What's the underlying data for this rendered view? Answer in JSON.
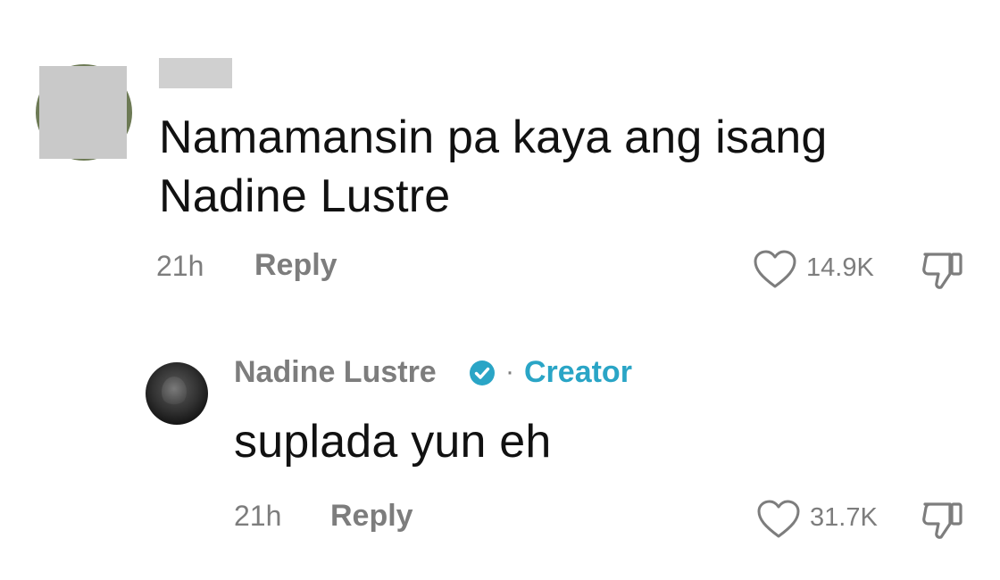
{
  "comments": [
    {
      "text": "Namamansin pa kaya ang isang Nadine Lustre",
      "time": "21h",
      "reply_label": "Reply",
      "likes": "14.9K"
    }
  ],
  "reply": {
    "username": "Nadine Lustre",
    "badge": "Creator",
    "separator": "·",
    "text": "suplada yun eh",
    "time": "21h",
    "reply_label": "Reply",
    "likes": "31.7K"
  },
  "colors": {
    "creator_accent": "#2aa5c6",
    "muted_text": "#7d7d7d",
    "primary_text": "#111111"
  },
  "icons": [
    "heart-icon",
    "dislike-icon",
    "verified-icon"
  ]
}
